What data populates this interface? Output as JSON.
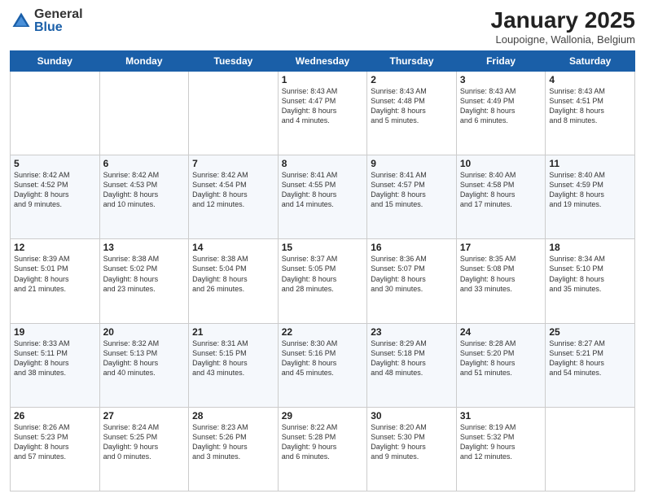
{
  "header": {
    "logo_general": "General",
    "logo_blue": "Blue",
    "title": "January 2025",
    "location": "Loupoigne, Wallonia, Belgium"
  },
  "days_of_week": [
    "Sunday",
    "Monday",
    "Tuesday",
    "Wednesday",
    "Thursday",
    "Friday",
    "Saturday"
  ],
  "weeks": [
    [
      {
        "day": "",
        "info": ""
      },
      {
        "day": "",
        "info": ""
      },
      {
        "day": "",
        "info": ""
      },
      {
        "day": "1",
        "info": "Sunrise: 8:43 AM\nSunset: 4:47 PM\nDaylight: 8 hours\nand 4 minutes."
      },
      {
        "day": "2",
        "info": "Sunrise: 8:43 AM\nSunset: 4:48 PM\nDaylight: 8 hours\nand 5 minutes."
      },
      {
        "day": "3",
        "info": "Sunrise: 8:43 AM\nSunset: 4:49 PM\nDaylight: 8 hours\nand 6 minutes."
      },
      {
        "day": "4",
        "info": "Sunrise: 8:43 AM\nSunset: 4:51 PM\nDaylight: 8 hours\nand 8 minutes."
      }
    ],
    [
      {
        "day": "5",
        "info": "Sunrise: 8:42 AM\nSunset: 4:52 PM\nDaylight: 8 hours\nand 9 minutes."
      },
      {
        "day": "6",
        "info": "Sunrise: 8:42 AM\nSunset: 4:53 PM\nDaylight: 8 hours\nand 10 minutes."
      },
      {
        "day": "7",
        "info": "Sunrise: 8:42 AM\nSunset: 4:54 PM\nDaylight: 8 hours\nand 12 minutes."
      },
      {
        "day": "8",
        "info": "Sunrise: 8:41 AM\nSunset: 4:55 PM\nDaylight: 8 hours\nand 14 minutes."
      },
      {
        "day": "9",
        "info": "Sunrise: 8:41 AM\nSunset: 4:57 PM\nDaylight: 8 hours\nand 15 minutes."
      },
      {
        "day": "10",
        "info": "Sunrise: 8:40 AM\nSunset: 4:58 PM\nDaylight: 8 hours\nand 17 minutes."
      },
      {
        "day": "11",
        "info": "Sunrise: 8:40 AM\nSunset: 4:59 PM\nDaylight: 8 hours\nand 19 minutes."
      }
    ],
    [
      {
        "day": "12",
        "info": "Sunrise: 8:39 AM\nSunset: 5:01 PM\nDaylight: 8 hours\nand 21 minutes."
      },
      {
        "day": "13",
        "info": "Sunrise: 8:38 AM\nSunset: 5:02 PM\nDaylight: 8 hours\nand 23 minutes."
      },
      {
        "day": "14",
        "info": "Sunrise: 8:38 AM\nSunset: 5:04 PM\nDaylight: 8 hours\nand 26 minutes."
      },
      {
        "day": "15",
        "info": "Sunrise: 8:37 AM\nSunset: 5:05 PM\nDaylight: 8 hours\nand 28 minutes."
      },
      {
        "day": "16",
        "info": "Sunrise: 8:36 AM\nSunset: 5:07 PM\nDaylight: 8 hours\nand 30 minutes."
      },
      {
        "day": "17",
        "info": "Sunrise: 8:35 AM\nSunset: 5:08 PM\nDaylight: 8 hours\nand 33 minutes."
      },
      {
        "day": "18",
        "info": "Sunrise: 8:34 AM\nSunset: 5:10 PM\nDaylight: 8 hours\nand 35 minutes."
      }
    ],
    [
      {
        "day": "19",
        "info": "Sunrise: 8:33 AM\nSunset: 5:11 PM\nDaylight: 8 hours\nand 38 minutes."
      },
      {
        "day": "20",
        "info": "Sunrise: 8:32 AM\nSunset: 5:13 PM\nDaylight: 8 hours\nand 40 minutes."
      },
      {
        "day": "21",
        "info": "Sunrise: 8:31 AM\nSunset: 5:15 PM\nDaylight: 8 hours\nand 43 minutes."
      },
      {
        "day": "22",
        "info": "Sunrise: 8:30 AM\nSunset: 5:16 PM\nDaylight: 8 hours\nand 45 minutes."
      },
      {
        "day": "23",
        "info": "Sunrise: 8:29 AM\nSunset: 5:18 PM\nDaylight: 8 hours\nand 48 minutes."
      },
      {
        "day": "24",
        "info": "Sunrise: 8:28 AM\nSunset: 5:20 PM\nDaylight: 8 hours\nand 51 minutes."
      },
      {
        "day": "25",
        "info": "Sunrise: 8:27 AM\nSunset: 5:21 PM\nDaylight: 8 hours\nand 54 minutes."
      }
    ],
    [
      {
        "day": "26",
        "info": "Sunrise: 8:26 AM\nSunset: 5:23 PM\nDaylight: 8 hours\nand 57 minutes."
      },
      {
        "day": "27",
        "info": "Sunrise: 8:24 AM\nSunset: 5:25 PM\nDaylight: 9 hours\nand 0 minutes."
      },
      {
        "day": "28",
        "info": "Sunrise: 8:23 AM\nSunset: 5:26 PM\nDaylight: 9 hours\nand 3 minutes."
      },
      {
        "day": "29",
        "info": "Sunrise: 8:22 AM\nSunset: 5:28 PM\nDaylight: 9 hours\nand 6 minutes."
      },
      {
        "day": "30",
        "info": "Sunrise: 8:20 AM\nSunset: 5:30 PM\nDaylight: 9 hours\nand 9 minutes."
      },
      {
        "day": "31",
        "info": "Sunrise: 8:19 AM\nSunset: 5:32 PM\nDaylight: 9 hours\nand 12 minutes."
      },
      {
        "day": "",
        "info": ""
      }
    ]
  ]
}
